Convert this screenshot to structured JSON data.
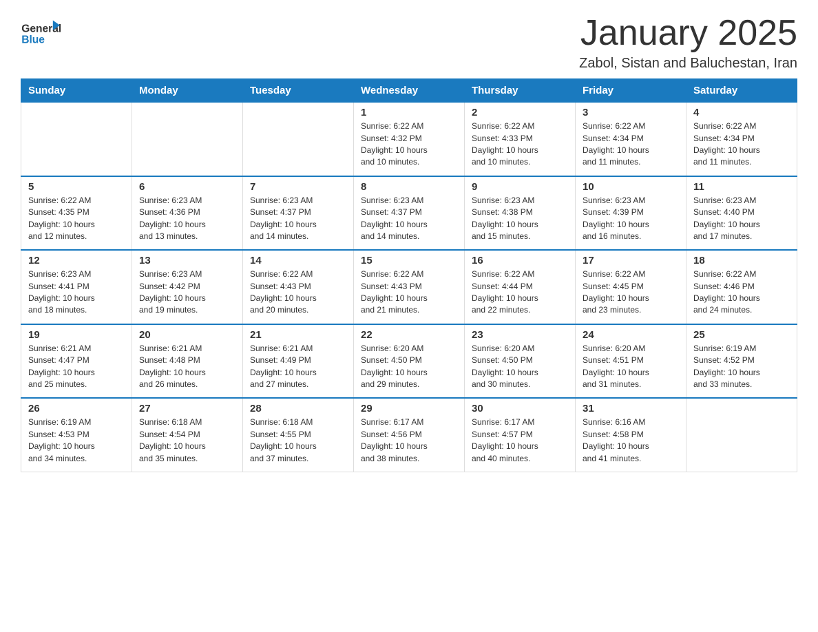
{
  "header": {
    "logo_general": "General",
    "logo_blue": "Blue",
    "month_title": "January 2025",
    "location": "Zabol, Sistan and Baluchestan, Iran"
  },
  "days_of_week": [
    "Sunday",
    "Monday",
    "Tuesday",
    "Wednesday",
    "Thursday",
    "Friday",
    "Saturday"
  ],
  "weeks": [
    [
      {
        "day": "",
        "info": ""
      },
      {
        "day": "",
        "info": ""
      },
      {
        "day": "",
        "info": ""
      },
      {
        "day": "1",
        "info": "Sunrise: 6:22 AM\nSunset: 4:32 PM\nDaylight: 10 hours\nand 10 minutes."
      },
      {
        "day": "2",
        "info": "Sunrise: 6:22 AM\nSunset: 4:33 PM\nDaylight: 10 hours\nand 10 minutes."
      },
      {
        "day": "3",
        "info": "Sunrise: 6:22 AM\nSunset: 4:34 PM\nDaylight: 10 hours\nand 11 minutes."
      },
      {
        "day": "4",
        "info": "Sunrise: 6:22 AM\nSunset: 4:34 PM\nDaylight: 10 hours\nand 11 minutes."
      }
    ],
    [
      {
        "day": "5",
        "info": "Sunrise: 6:22 AM\nSunset: 4:35 PM\nDaylight: 10 hours\nand 12 minutes."
      },
      {
        "day": "6",
        "info": "Sunrise: 6:23 AM\nSunset: 4:36 PM\nDaylight: 10 hours\nand 13 minutes."
      },
      {
        "day": "7",
        "info": "Sunrise: 6:23 AM\nSunset: 4:37 PM\nDaylight: 10 hours\nand 14 minutes."
      },
      {
        "day": "8",
        "info": "Sunrise: 6:23 AM\nSunset: 4:37 PM\nDaylight: 10 hours\nand 14 minutes."
      },
      {
        "day": "9",
        "info": "Sunrise: 6:23 AM\nSunset: 4:38 PM\nDaylight: 10 hours\nand 15 minutes."
      },
      {
        "day": "10",
        "info": "Sunrise: 6:23 AM\nSunset: 4:39 PM\nDaylight: 10 hours\nand 16 minutes."
      },
      {
        "day": "11",
        "info": "Sunrise: 6:23 AM\nSunset: 4:40 PM\nDaylight: 10 hours\nand 17 minutes."
      }
    ],
    [
      {
        "day": "12",
        "info": "Sunrise: 6:23 AM\nSunset: 4:41 PM\nDaylight: 10 hours\nand 18 minutes."
      },
      {
        "day": "13",
        "info": "Sunrise: 6:23 AM\nSunset: 4:42 PM\nDaylight: 10 hours\nand 19 minutes."
      },
      {
        "day": "14",
        "info": "Sunrise: 6:22 AM\nSunset: 4:43 PM\nDaylight: 10 hours\nand 20 minutes."
      },
      {
        "day": "15",
        "info": "Sunrise: 6:22 AM\nSunset: 4:43 PM\nDaylight: 10 hours\nand 21 minutes."
      },
      {
        "day": "16",
        "info": "Sunrise: 6:22 AM\nSunset: 4:44 PM\nDaylight: 10 hours\nand 22 minutes."
      },
      {
        "day": "17",
        "info": "Sunrise: 6:22 AM\nSunset: 4:45 PM\nDaylight: 10 hours\nand 23 minutes."
      },
      {
        "day": "18",
        "info": "Sunrise: 6:22 AM\nSunset: 4:46 PM\nDaylight: 10 hours\nand 24 minutes."
      }
    ],
    [
      {
        "day": "19",
        "info": "Sunrise: 6:21 AM\nSunset: 4:47 PM\nDaylight: 10 hours\nand 25 minutes."
      },
      {
        "day": "20",
        "info": "Sunrise: 6:21 AM\nSunset: 4:48 PM\nDaylight: 10 hours\nand 26 minutes."
      },
      {
        "day": "21",
        "info": "Sunrise: 6:21 AM\nSunset: 4:49 PM\nDaylight: 10 hours\nand 27 minutes."
      },
      {
        "day": "22",
        "info": "Sunrise: 6:20 AM\nSunset: 4:50 PM\nDaylight: 10 hours\nand 29 minutes."
      },
      {
        "day": "23",
        "info": "Sunrise: 6:20 AM\nSunset: 4:50 PM\nDaylight: 10 hours\nand 30 minutes."
      },
      {
        "day": "24",
        "info": "Sunrise: 6:20 AM\nSunset: 4:51 PM\nDaylight: 10 hours\nand 31 minutes."
      },
      {
        "day": "25",
        "info": "Sunrise: 6:19 AM\nSunset: 4:52 PM\nDaylight: 10 hours\nand 33 minutes."
      }
    ],
    [
      {
        "day": "26",
        "info": "Sunrise: 6:19 AM\nSunset: 4:53 PM\nDaylight: 10 hours\nand 34 minutes."
      },
      {
        "day": "27",
        "info": "Sunrise: 6:18 AM\nSunset: 4:54 PM\nDaylight: 10 hours\nand 35 minutes."
      },
      {
        "day": "28",
        "info": "Sunrise: 6:18 AM\nSunset: 4:55 PM\nDaylight: 10 hours\nand 37 minutes."
      },
      {
        "day": "29",
        "info": "Sunrise: 6:17 AM\nSunset: 4:56 PM\nDaylight: 10 hours\nand 38 minutes."
      },
      {
        "day": "30",
        "info": "Sunrise: 6:17 AM\nSunset: 4:57 PM\nDaylight: 10 hours\nand 40 minutes."
      },
      {
        "day": "31",
        "info": "Sunrise: 6:16 AM\nSunset: 4:58 PM\nDaylight: 10 hours\nand 41 minutes."
      },
      {
        "day": "",
        "info": ""
      }
    ]
  ]
}
